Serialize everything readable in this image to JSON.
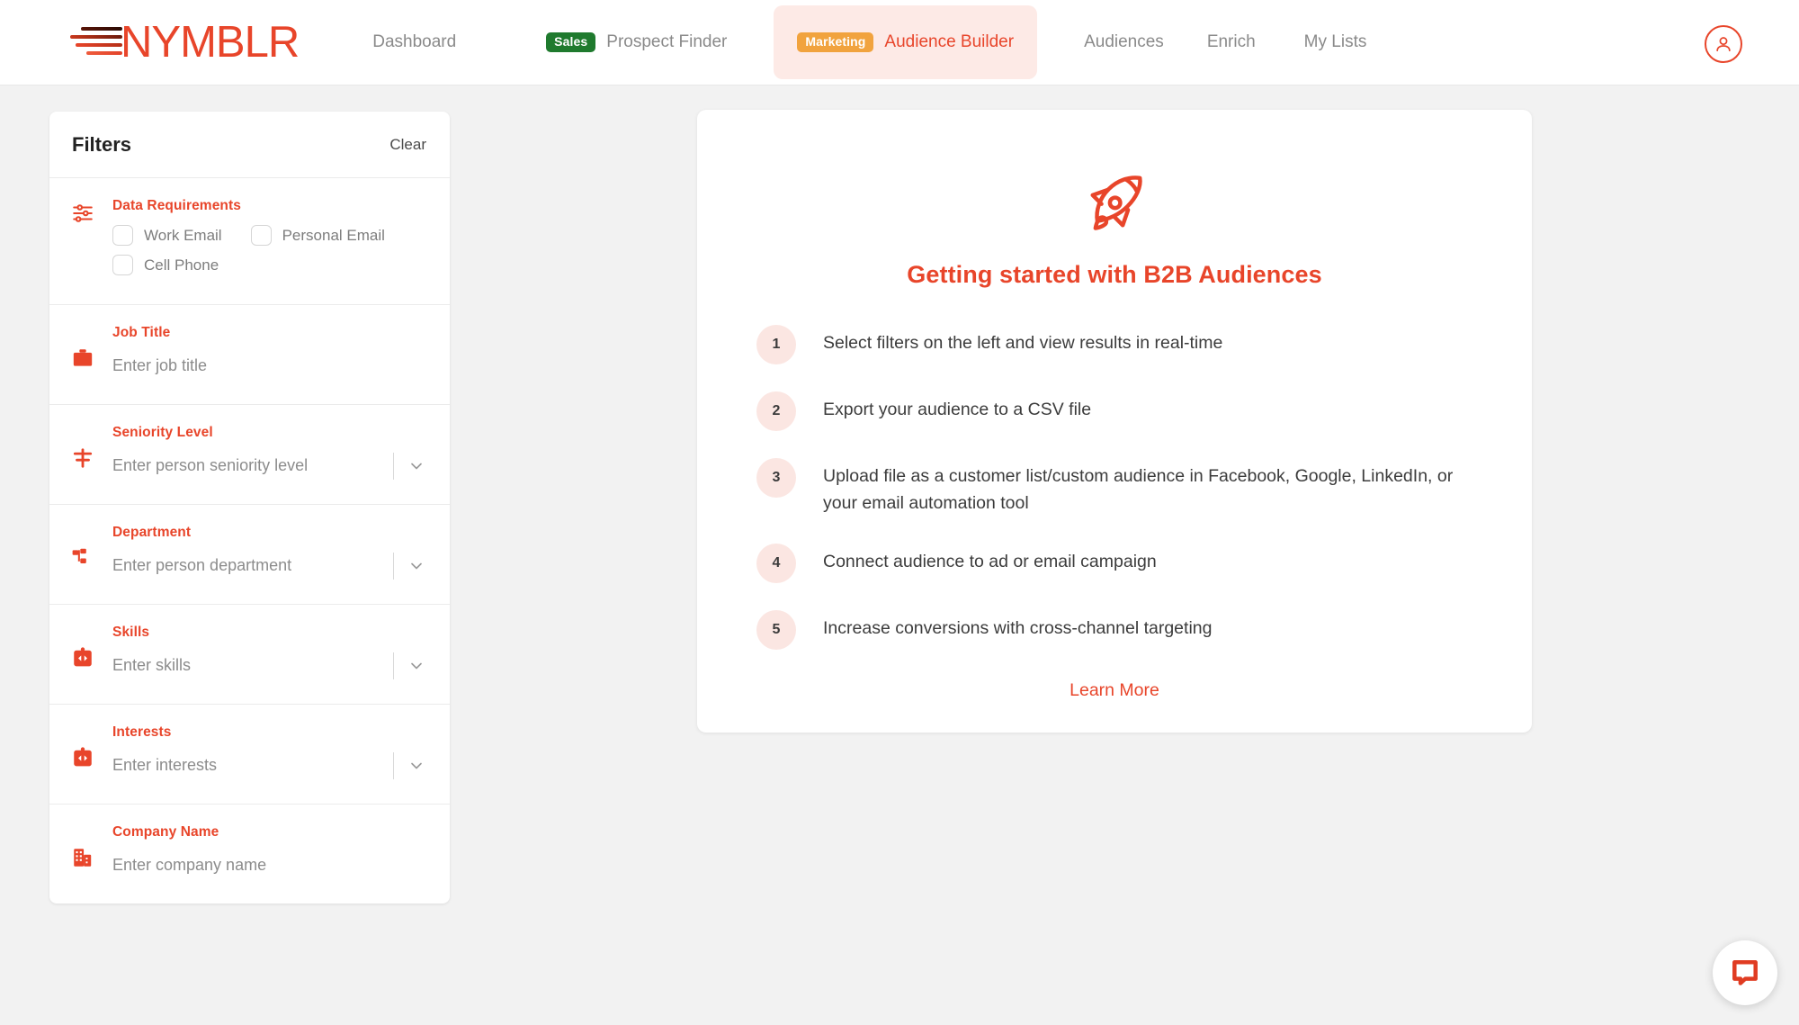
{
  "brand": {
    "logo_text": "NYMBLR",
    "accent": "#e8452a",
    "sales_tag_color": "#1f7a2e",
    "marketing_tag_color": "#f1a33e"
  },
  "nav": {
    "dashboard": "Dashboard",
    "prospect_finder": {
      "tag": "Sales",
      "label": "Prospect Finder"
    },
    "audience_builder": {
      "tag": "Marketing",
      "label": "Audience Builder",
      "active": true
    },
    "audiences": "Audiences",
    "enrich": "Enrich",
    "my_lists": "My Lists",
    "account_icon": "user-circle-icon"
  },
  "filters": {
    "title": "Filters",
    "clear_label": "Clear",
    "data_requirements": {
      "label": "Data Requirements",
      "icon": "sliders-icon",
      "options": [
        {
          "label": "Work Email",
          "checked": false
        },
        {
          "label": "Personal Email",
          "checked": false
        },
        {
          "label": "Cell Phone",
          "checked": false
        }
      ]
    },
    "rows": [
      {
        "label": "Job Title",
        "placeholder": "Enter job title",
        "icon": "briefcase-icon",
        "value": "",
        "dropdown": false
      },
      {
        "label": "Seniority Level",
        "placeholder": "Enter person seniority level",
        "icon": "seniority-levels-icon",
        "value": "",
        "dropdown": true
      },
      {
        "label": "Department",
        "placeholder": "Enter person department",
        "icon": "org-chart-icon",
        "value": "",
        "dropdown": true
      },
      {
        "label": "Skills",
        "placeholder": "Enter skills",
        "icon": "clipboard-code-icon",
        "value": "",
        "dropdown": true
      },
      {
        "label": "Interests",
        "placeholder": "Enter interests",
        "icon": "clipboard-code-icon",
        "value": "",
        "dropdown": true
      },
      {
        "label": "Company Name",
        "placeholder": "Enter company name",
        "icon": "building-icon",
        "value": "",
        "dropdown": false
      }
    ]
  },
  "getting_started": {
    "icon": "rocket-icon",
    "title": "Getting started with B2B Audiences",
    "steps": [
      {
        "number": "1",
        "text": "Select filters on the left and view results in real-time"
      },
      {
        "number": "2",
        "text": "Export your audience to a CSV file"
      },
      {
        "number": "3",
        "text": "Upload file as a customer list/custom audience in Facebook, Google, LinkedIn, or your email automation tool"
      },
      {
        "number": "4",
        "text": "Connect audience to ad or email campaign"
      },
      {
        "number": "5",
        "text": "Increase conversions with cross-channel targeting"
      }
    ],
    "learn_more": "Learn More"
  },
  "chat": {
    "icon": "chat-bubble-icon"
  }
}
